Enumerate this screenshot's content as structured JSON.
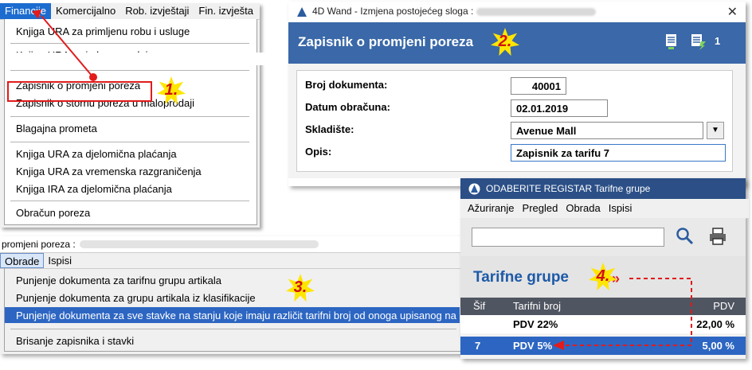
{
  "menu_financije": {
    "bar": [
      "Financije",
      "Komercijalno",
      "Rob. izvještaji",
      "Fin. izvješta"
    ],
    "items": [
      "Knjiga URA za primljenu robu i usluge",
      "Knjiga URA za izdane predujmove",
      "Zapisnik o promjeni poreza",
      "Zapisnik o stornu poreza u maloprodaji",
      "Blagajna prometa",
      "Knjiga URA za djelomična plaćanja",
      "Knjiga URA za vremenska razgraničenja",
      "Knjiga IRA za djelomična plaćanja",
      "Obračun poreza"
    ]
  },
  "dialog": {
    "title": "4D Wand - Izmjena postojećeg sloga :",
    "close": "✕",
    "header": "Zapisnik o promjeni poreza",
    "attachment_count": "1",
    "fields": [
      {
        "label": "Broj dokumenta:",
        "value": "40001"
      },
      {
        "label": "Datum obračuna:",
        "value": "02.01.2019"
      },
      {
        "label": "Skladište:",
        "value": "Avenue Mall"
      },
      {
        "label": "Opis:",
        "value": "Zapisnik za tarifu 7"
      }
    ]
  },
  "menu_obrade": {
    "title": "promjeni poreza :",
    "bar": [
      "Obrade",
      "Ispisi"
    ],
    "items": [
      "Punjenje dokumenta za tarifnu grupu artikala",
      "Punjenje dokumenta za grupu artikala iz klasifikacije",
      "Punjenje dokumenta za sve stavke na stanju koje imaju različit tarifni broj od onoga upisanog na artiklu",
      "Brisanje zapisnika i stavki"
    ]
  },
  "register": {
    "title": "ODABERITE REGISTAR Tarifne grupe",
    "menu": [
      "Ažuriranje",
      "Pregled",
      "Obrada",
      "Ispisi"
    ],
    "header": "Tarifne grupe",
    "columns": [
      "Šif",
      "Tarifni broj",
      "PDV"
    ],
    "rows": [
      {
        "sifra": "",
        "naziv": "PDV 22%",
        "pdv": "22,00 %"
      },
      {
        "sifra": "7",
        "naziv": "PDV 5%",
        "pdv": "5,00 %"
      }
    ]
  },
  "steps": [
    "1.",
    "2.",
    "3.",
    "4."
  ],
  "colors": {
    "accent": "#3a68a8",
    "highlight": "#2d66c2",
    "annotation": "#e21b1b",
    "badge": "#ffe600"
  }
}
